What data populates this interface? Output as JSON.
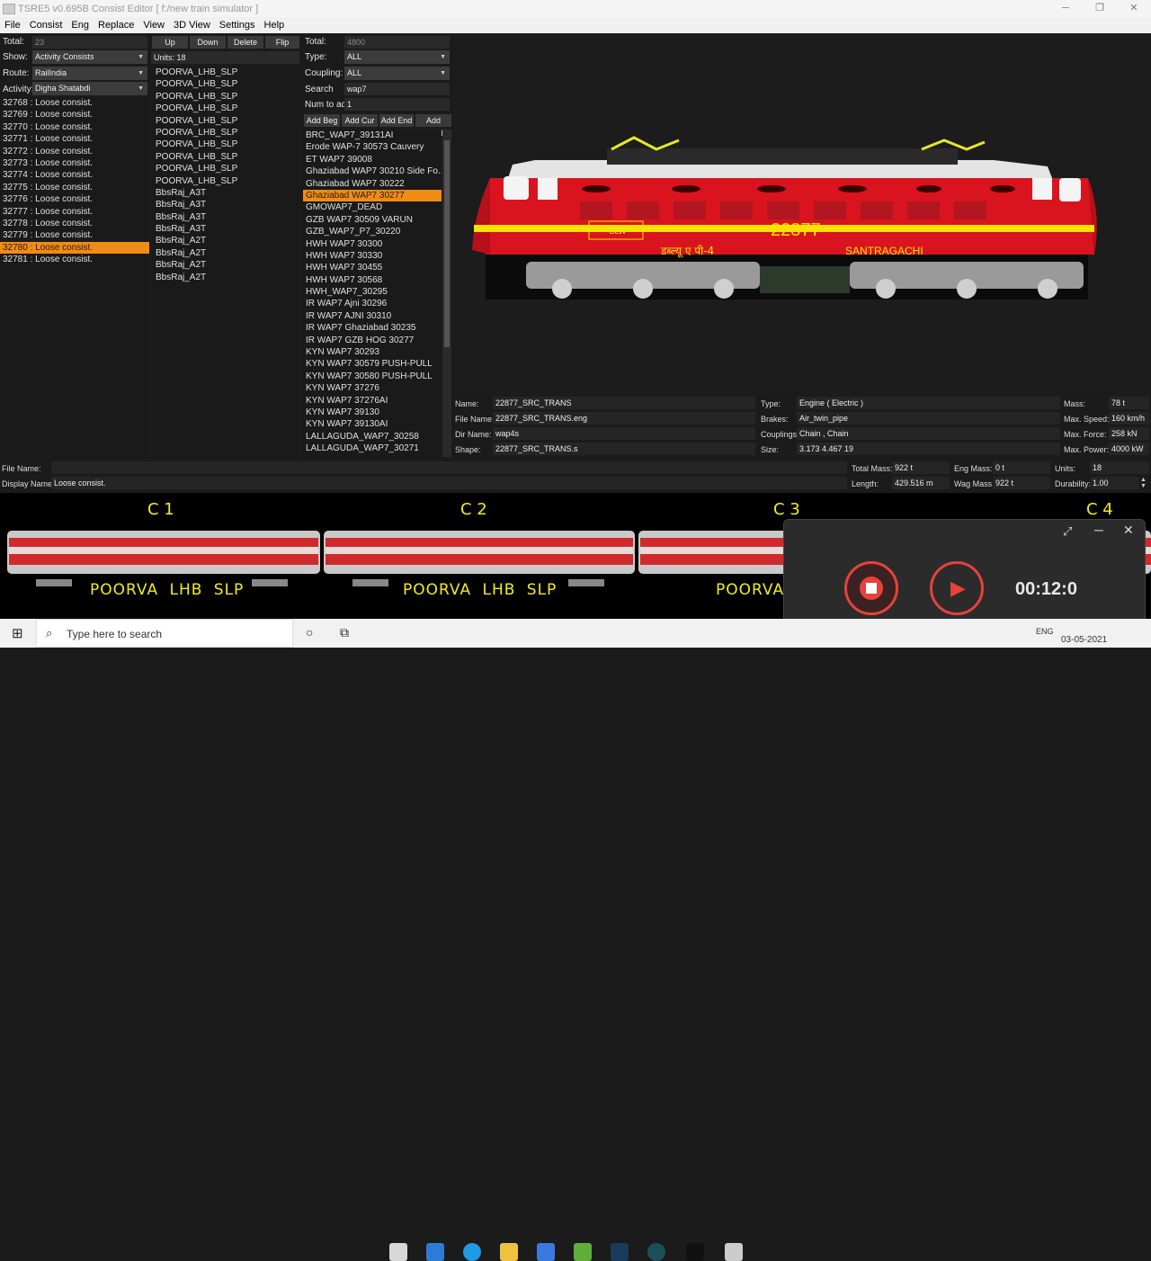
{
  "window": {
    "title": "TSRE5 v0.695B Consist Editor  [ f:/new train simulator ]",
    "buttons": [
      "─",
      "❐",
      "✕"
    ]
  },
  "menu": [
    "File",
    "Consist",
    "Eng",
    "Replace",
    "View",
    "3D View",
    "Settings",
    "Help"
  ],
  "left": {
    "total_label": "Total:",
    "total": "23",
    "show_label": "Show:",
    "show": "Activity Consists",
    "route_label": "Route:",
    "route": "RailIndia",
    "activity_label": "Activity:",
    "activity": "Digha Shatabdi",
    "consists": [
      "32768 : Loose consist.",
      "32769 : Loose consist.",
      "32770 : Loose consist.",
      "32771 : Loose consist.",
      "32772 : Loose consist.",
      "32773 : Loose consist.",
      "32774 : Loose consist.",
      "32775 : Loose consist.",
      "32776 : Loose consist.",
      "32777 : Loose consist.",
      "32778 : Loose consist.",
      "32779 : Loose consist.",
      "32780 : Loose consist.",
      "32781 : Loose consist."
    ],
    "selected_index": 12
  },
  "units": {
    "buttons": {
      "up": "Up",
      "down": "Down",
      "delete": "Delete",
      "flip": "Flip"
    },
    "label": "Units: 18",
    "items": [
      "POORVA_LHB_SLP",
      "POORVA_LHB_SLP",
      "POORVA_LHB_SLP",
      "POORVA_LHB_SLP",
      "POORVA_LHB_SLP",
      "POORVA_LHB_SLP",
      "POORVA_LHB_SLP",
      "POORVA_LHB_SLP",
      "POORVA_LHB_SLP",
      "POORVA_LHB_SLP",
      "BbsRaj_A3T",
      "BbsRaj_A3T",
      "BbsRaj_A3T",
      "BbsRaj_A3T",
      "BbsRaj_A2T",
      "BbsRaj_A2T",
      "BbsRaj_A2T",
      "BbsRaj_A2T"
    ]
  },
  "library": {
    "total_label": "Total:",
    "total": "4800",
    "type_label": "Type:",
    "type": "ALL",
    "coupling_label": "Coupling:",
    "coupling": "ALL",
    "search_label": "Search",
    "search": "wap7",
    "num_label": "Num to add",
    "num": "1",
    "buttons": {
      "add_beg": "Add Beg",
      "add_cur": "Add Cur",
      "add_end": "Add End",
      "add_rand": "Add Rand"
    },
    "items": [
      "BRC_WAP7_39131AI",
      "Erode WAP-7 30573 Cauvery",
      "ET WAP7 39008",
      "Ghaziabad WAP7 30210 Side Fo...",
      "Ghaziabad WAP7 30222",
      "Ghaziabad WAP7 30277",
      "GMOWAP7_DEAD",
      "GZB WAP7 30509 VARUN",
      "GZB_WAP7_P7_30220",
      "HWH WAP7 30300",
      "HWH WAP7 30330",
      "HWH WAP7 30455",
      "HWH WAP7 30568",
      "HWH_WAP7_30295",
      "IR WAP7 Ajni 30296",
      "IR WAP7 AJNI 30310",
      "IR WAP7 Ghaziabad 30235",
      "IR WAP7 GZB HOG 30277",
      "KYN WAP7 30293",
      "KYN WAP7 30579 PUSH-PULL",
      "KYN WAP7 30580 PUSH-PULL",
      "KYN WAP7 37276",
      "KYN WAP7 37276AI",
      "KYN WAP7 39130",
      "KYN WAP7 39130AI",
      "LALLAGUDA_WAP7_30258",
      "LALLAGUDA_WAP7_30271"
    ],
    "selected_index": 5
  },
  "loco": {
    "number": "22877",
    "shed": "SANTRAGACHI",
    "hindi": "डब्ल्यू ए पी-4",
    "badge": "CLW"
  },
  "props": {
    "name_l": "Name:",
    "name": "22877_SRC_TRANS",
    "file_l": "File Name:",
    "file": "22877_SRC_TRANS.eng",
    "dir_l": "Dir Name:",
    "dir": "wap4s",
    "shape_l": "Shape:",
    "shape": "22877_SRC_TRANS.s",
    "type_l": "Type:",
    "type": "Engine ( Electric )",
    "brakes_l": "Brakes:",
    "brakes": "Air_twin_pipe",
    "couplings_l": "Couplings:",
    "couplings": "Chain , Chain",
    "size_l": "Size:",
    "size": "3.173 4.467 19",
    "mass_l": "Mass:",
    "mass": "78 t",
    "maxspeed_l": "Max. Speed:",
    "maxspeed": "160 km/h",
    "maxforce_l": "Max. Force:",
    "maxforce": "258 kN",
    "maxpower_l": "Max. Power:",
    "maxpower": "4000 kW"
  },
  "consist": {
    "filename_l": "File Name:",
    "filename": "",
    "display_l": "Display Name:",
    "display": "Loose consist.",
    "totalmass_l": "Total Mass:",
    "totalmass": "922 t",
    "engmass_l": "Eng Mass:",
    "engmass": "0 t",
    "units_l": "Units:",
    "units": "18",
    "length_l": "Length:",
    "length": "429.516 m",
    "wagmass_l": "Wag Mass:",
    "wagmass": "922 t",
    "durability_l": "Durability:",
    "durability": "1.00"
  },
  "strip": {
    "labels": [
      "C 1",
      "C 2",
      "C 3",
      "C 4"
    ],
    "names": [
      "POORVA LHB SLP",
      "POORVA LHB SLP",
      "POORVA"
    ]
  },
  "recorder": {
    "time": "00:12:0"
  },
  "taskbar": {
    "search": "Type here to search",
    "lang": "ENG",
    "date": "03-05-2021"
  },
  "colors": {
    "accent": "#f08c14",
    "loco_red": "#d9141e",
    "stripe_yellow": "#f6e400",
    "record_red": "#e8413a"
  }
}
